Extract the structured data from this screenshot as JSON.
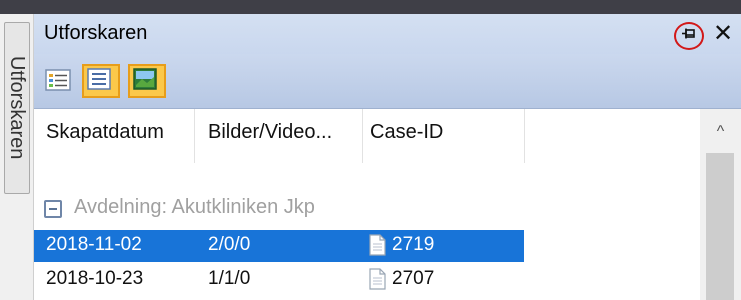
{
  "side_tab": {
    "label": "Utforskaren"
  },
  "panel": {
    "title": "Utforskaren",
    "pin_icon": "pin-icon",
    "close_label": "✕"
  },
  "toolbar": {
    "buttons": [
      {
        "icon": "details-view-icon",
        "active": false
      },
      {
        "icon": "list-view-icon",
        "active": true
      },
      {
        "icon": "thumbnail-view-icon",
        "active": true
      }
    ]
  },
  "table": {
    "columns": [
      "Skapatdatum",
      "Bilder/Video...",
      "Case-ID"
    ],
    "group_label": "Avdelning: Akutkliniken Jkp",
    "rows": [
      {
        "date": "2018-11-02",
        "media": "2/0/0",
        "case_id": "2719",
        "selected": true
      },
      {
        "date": "2018-10-23",
        "media": "1/1/0",
        "case_id": "2707",
        "selected": false
      }
    ]
  },
  "scrollbar": {
    "up_arrow": "^"
  },
  "colors": {
    "selection": "#1874d8",
    "highlight_ring": "#d21818",
    "toolbar_active": "#fbc84a"
  }
}
